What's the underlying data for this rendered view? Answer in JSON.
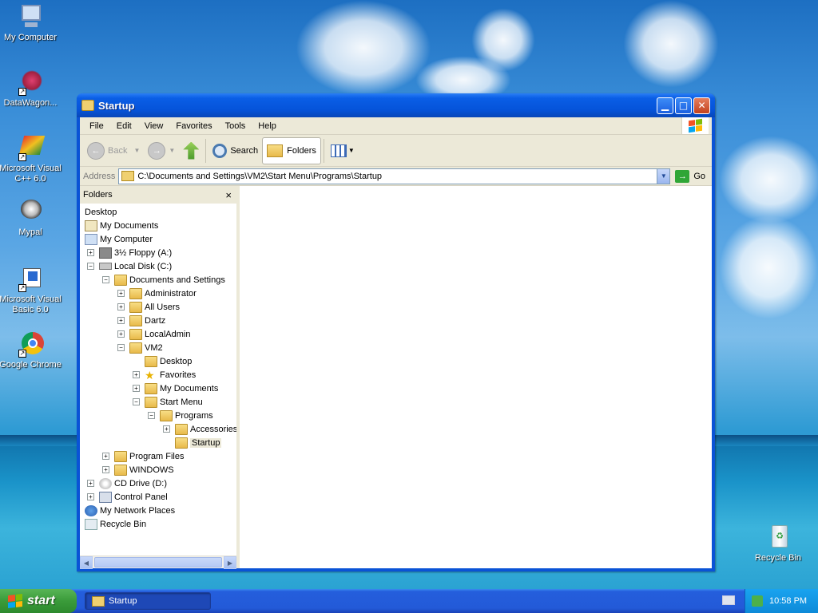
{
  "desktop": {
    "icons": [
      {
        "label": "My Computer",
        "icon": "computer-icon"
      },
      {
        "label": "DataWagon...",
        "icon": "datawagon-icon"
      },
      {
        "label": "Microsoft Visual C++ 6.0",
        "icon": "visual-cpp-icon"
      },
      {
        "label": "Mypal",
        "icon": "mypal-icon"
      },
      {
        "label": "Microsoft Visual Basic 6.0",
        "icon": "visual-basic-icon"
      },
      {
        "label": "Google Chrome",
        "icon": "chrome-icon"
      },
      {
        "label": "Recycle Bin",
        "icon": "recycle-bin-icon"
      }
    ]
  },
  "window": {
    "title": "Startup",
    "menu": [
      "File",
      "Edit",
      "View",
      "Favorites",
      "Tools",
      "Help"
    ],
    "toolbar": {
      "back": "Back",
      "search": "Search",
      "folders": "Folders"
    },
    "address": {
      "label": "Address",
      "value": "C:\\Documents and Settings\\VM2\\Start Menu\\Programs\\Startup",
      "go": "Go"
    },
    "folders_pane": {
      "title": "Folders",
      "close": "×",
      "tree": [
        {
          "label": "Desktop"
        },
        {
          "label": "My Documents"
        },
        {
          "label": "My Computer"
        },
        {
          "label": "3½ Floppy (A:)"
        },
        {
          "label": "Local Disk (C:)"
        },
        {
          "label": "Documents and Settings"
        },
        {
          "label": "Administrator"
        },
        {
          "label": "All Users"
        },
        {
          "label": "Dartz"
        },
        {
          "label": "LocalAdmin"
        },
        {
          "label": "VM2"
        },
        {
          "label": "Desktop"
        },
        {
          "label": "Favorites"
        },
        {
          "label": "My Documents"
        },
        {
          "label": "Start Menu"
        },
        {
          "label": "Programs"
        },
        {
          "label": "Accessories"
        },
        {
          "label": "Startup"
        },
        {
          "label": "Program Files"
        },
        {
          "label": "WINDOWS"
        },
        {
          "label": "CD Drive (D:)"
        },
        {
          "label": "Control Panel"
        },
        {
          "label": "My Network Places"
        },
        {
          "label": "Recycle Bin"
        }
      ]
    }
  },
  "taskbar": {
    "start": "start",
    "task": "Startup",
    "clock": "10:58 PM"
  },
  "colors": {
    "titlebar": "#0553d9",
    "taskbar": "#245edc",
    "start": "#3a9b3a"
  }
}
